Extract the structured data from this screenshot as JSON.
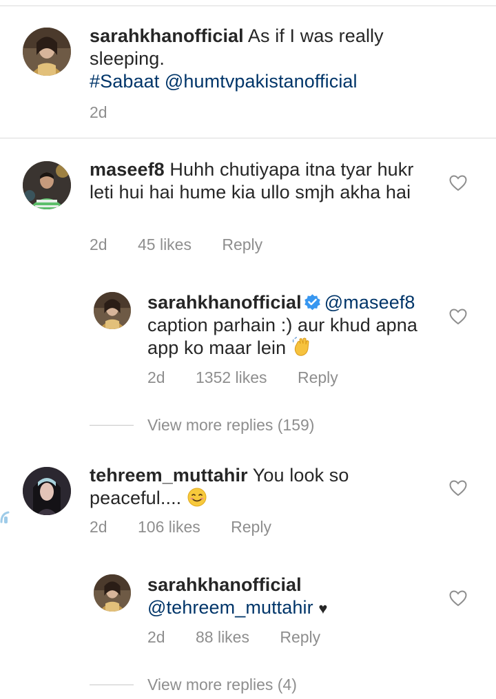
{
  "comments": [
    {
      "username": "sarahkhanofficial",
      "text": "As if I was really sleeping.",
      "links": "#Sabaat @humtvpakistanofficial",
      "time": "2d",
      "avatar_icon": "avatar-woman-photo"
    },
    {
      "username": "maseef8",
      "text": "Huhh chutiyapa itna tyar hukr leti hui hai hume kia ullo smjh akha hai",
      "time": "2d",
      "likes": "45 likes",
      "reply_label": "Reply",
      "avatar_icon": "avatar-man-photo",
      "replies": [
        {
          "username": "sarahkhanofficial",
          "mention": "@maseef8",
          "text": "caption parhain :) aur khud apna app ko maar lein",
          "emoji": "waving-hand",
          "time": "2d",
          "likes": "1352 likes",
          "reply_label": "Reply"
        }
      ],
      "view_more": "View more replies (159)"
    },
    {
      "username": "tehreem_muttahir",
      "text": "You look so peaceful....",
      "emoji": "smiling-face",
      "time": "2d",
      "likes": "106 likes",
      "reply_label": "Reply",
      "avatar_icon": "avatar-girl-photo",
      "replies": [
        {
          "username": "sarahkhanofficial",
          "mention": "@tehreem_muttahir",
          "text": "♥",
          "time": "2d",
          "likes": "88 likes",
          "reply_label": "Reply"
        }
      ],
      "view_more": "View more replies (4)"
    }
  ],
  "colors": {
    "link": "#003569",
    "meta": "#8e8e8e",
    "text": "#262626",
    "verified": "#3897f0"
  }
}
